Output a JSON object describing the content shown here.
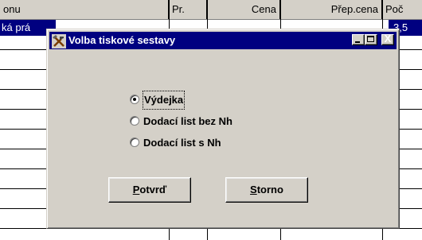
{
  "table": {
    "columns": [
      {
        "label": "onu",
        "align": "left"
      },
      {
        "label": "Pr.",
        "align": "left"
      },
      {
        "label": "Cena",
        "align": "right"
      },
      {
        "label": "Přep.cena",
        "align": "right"
      },
      {
        "label": "Poč",
        "align": "left"
      }
    ],
    "selected_row": {
      "left_text": "ká prá",
      "right_text": "3,5"
    }
  },
  "dialog": {
    "title": "Volba tiskové sestavy",
    "title_icon": "tools-icon",
    "window_buttons": {
      "minimize": "_",
      "maximize": "□",
      "close": "X"
    },
    "options": [
      {
        "label": "Výdejka",
        "checked": true
      },
      {
        "label": "Dodací list bez Nh",
        "checked": false
      },
      {
        "label": "Dodací list s Nh",
        "checked": false
      }
    ],
    "buttons": {
      "confirm_prefix": "P",
      "confirm_rest": "otvrď",
      "cancel_prefix": "S",
      "cancel_rest": "torno"
    }
  },
  "colors": {
    "titlebar": "#000080",
    "face": "#d4d0c8",
    "selection": "#000080"
  }
}
